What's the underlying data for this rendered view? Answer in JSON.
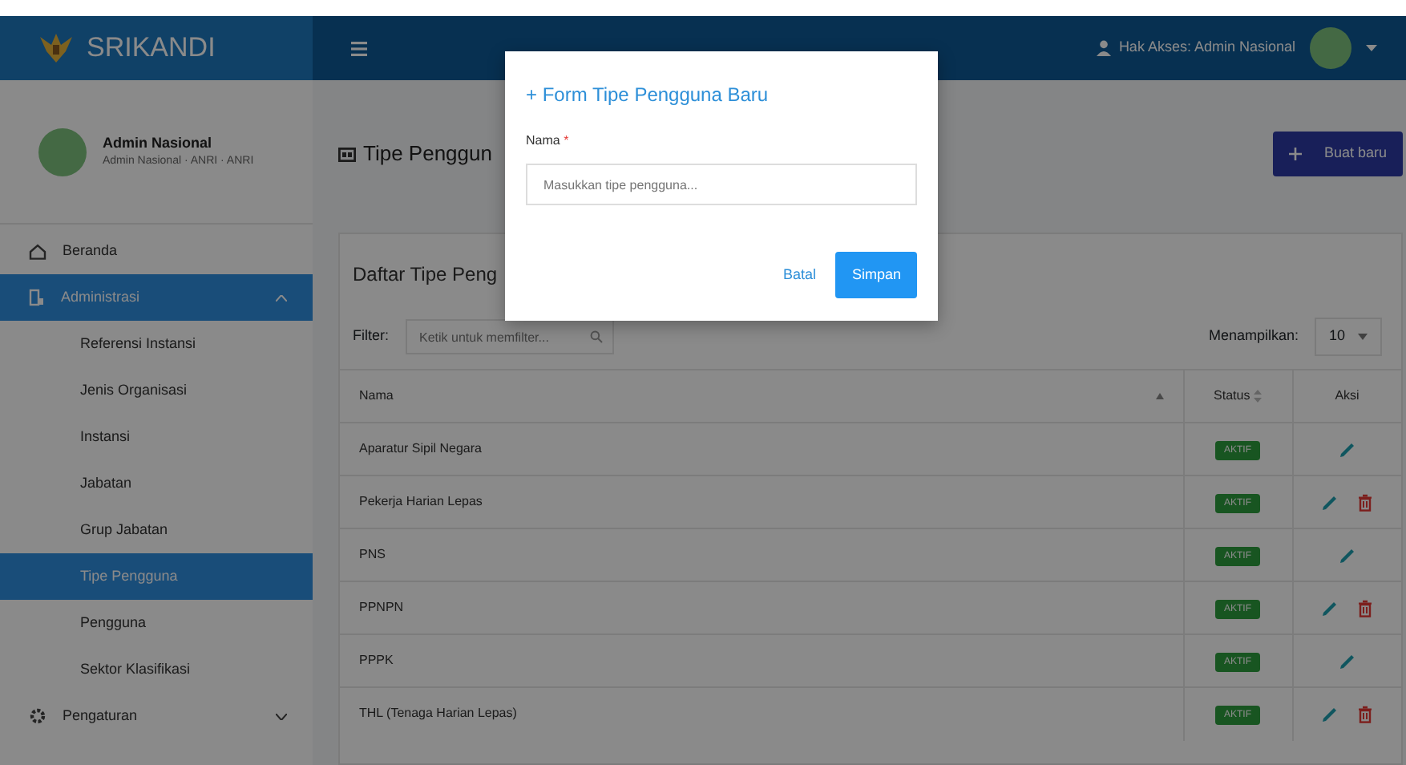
{
  "brand": "SRIKANDI",
  "user": {
    "name": "Admin Nasional",
    "subtitle": "Admin Nasional · ANRI · ANRI"
  },
  "header": {
    "access": "Hak Akses: Admin Nasional"
  },
  "sidebar": {
    "items": [
      {
        "label": "Beranda",
        "selected": false
      },
      {
        "label": "Administrasi",
        "selected": true,
        "expanded": true,
        "children": [
          {
            "label": "Referensi Instansi",
            "selected": false
          },
          {
            "label": "Jenis Organisasi",
            "selected": false
          },
          {
            "label": "Instansi",
            "selected": false
          },
          {
            "label": "Jabatan",
            "selected": false
          },
          {
            "label": "Grup Jabatan",
            "selected": false
          },
          {
            "label": "Tipe Pengguna",
            "selected": true
          },
          {
            "label": "Pengguna",
            "selected": false
          },
          {
            "label": "Sektor Klasifikasi",
            "selected": false
          }
        ]
      },
      {
        "label": "Pengaturan",
        "selected": false,
        "expanded": false
      }
    ]
  },
  "page": {
    "title": "Tipe Penggun",
    "create_button": "Buat baru"
  },
  "card": {
    "title": "Daftar Tipe Peng",
    "filter_label": "Filter:",
    "filter_placeholder": "Ketik untuk memfilter...",
    "show_label": "Menampilkan:",
    "page_size": "10"
  },
  "table": {
    "columns": [
      "Nama",
      "Status",
      "Aksi"
    ],
    "rows": [
      {
        "name": "Aparatur Sipil Negara",
        "status": "AKTIF",
        "deletable": false
      },
      {
        "name": "Pekerja Harian Lepas",
        "status": "AKTIF",
        "deletable": true
      },
      {
        "name": "PNS",
        "status": "AKTIF",
        "deletable": false
      },
      {
        "name": "PPNPN",
        "status": "AKTIF",
        "deletable": true
      },
      {
        "name": "PPPK",
        "status": "AKTIF",
        "deletable": false
      },
      {
        "name": "THL (Tenaga Harian Lepas)",
        "status": "AKTIF",
        "deletable": true
      }
    ]
  },
  "modal": {
    "title": "Form Tipe Pengguna Baru",
    "plus": "+",
    "field_label": "Nama",
    "required_mark": "*",
    "placeholder": "Masukkan tipe pengguna...",
    "cancel": "Batal",
    "save": "Simpan"
  }
}
